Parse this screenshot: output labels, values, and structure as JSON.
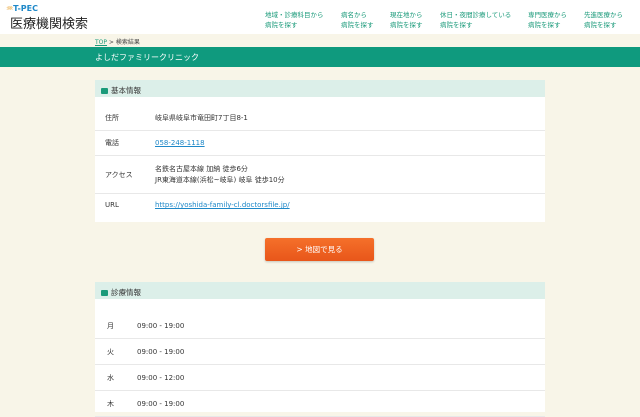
{
  "header": {
    "logo_brand": "T-PEC",
    "logo_title": "医療機関検索",
    "nav": [
      {
        "l1": "地域・診療科目から",
        "l2": "病院を探す"
      },
      {
        "l1": "病名から",
        "l2": "病院を探す"
      },
      {
        "l1": "現在地から",
        "l2": "病院を探す"
      },
      {
        "l1": "休日・夜間診療している",
        "l2": "病院を探す"
      },
      {
        "l1": "専門医療から",
        "l2": "病院を探す"
      },
      {
        "l1": "先進医療から",
        "l2": "病院を探す"
      }
    ]
  },
  "breadcrumb": {
    "top": "TOP",
    "sep": " > ",
    "current": "検索結果"
  },
  "clinic_name": "よしだファミリークリニック",
  "basic": {
    "title": "基本情報",
    "address_label": "住所",
    "address": "岐阜県岐阜市竜田町7丁目8-1",
    "phone_label": "電話",
    "phone": "058-248-1118",
    "access_label": "アクセス",
    "access1": "名鉄名古屋本線 加納 徒歩6分",
    "access2": "JR東海道本線(浜松~岐阜) 岐阜 徒歩10分",
    "url_label": "URL",
    "url": "https://yoshida-family-cl.doctorsfile.jp/"
  },
  "map_button": "> 地図で見る",
  "hours": {
    "title": "診療情報",
    "rows": [
      {
        "day": "月",
        "time": "09:00 - 19:00"
      },
      {
        "day": "火",
        "time": "09:00 - 19:00"
      },
      {
        "day": "水",
        "time": "09:00 - 12:00"
      },
      {
        "day": "木",
        "time": "09:00 - 19:00"
      }
    ]
  }
}
